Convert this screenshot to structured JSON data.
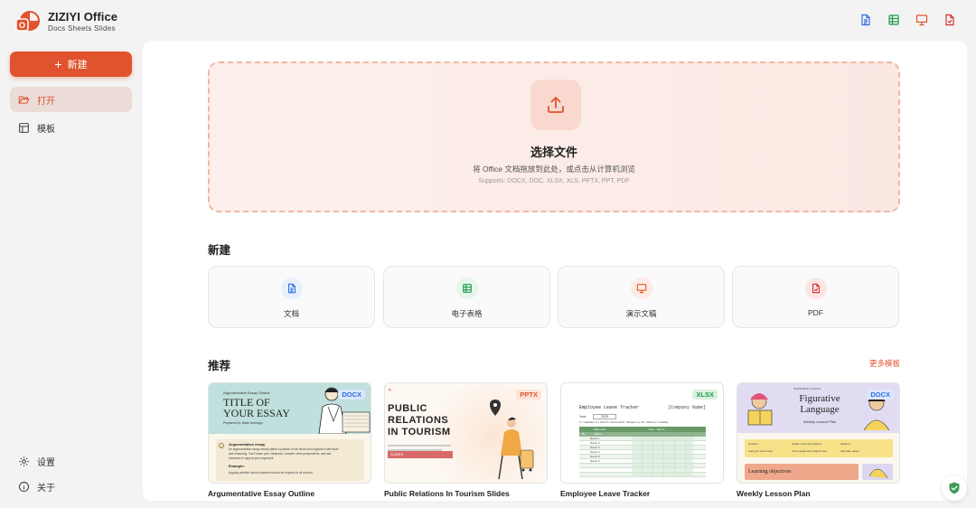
{
  "app": {
    "title": "ZIZIYI Office",
    "subtitle": "Docs  Sheets  Slides"
  },
  "sidebar": {
    "new_button": "新建",
    "items": [
      {
        "label": "打开",
        "icon": "folder-open-icon",
        "active": true
      },
      {
        "label": "模板",
        "icon": "template-icon",
        "active": false
      }
    ],
    "bottom": [
      {
        "label": "设置",
        "icon": "gear-icon"
      },
      {
        "label": "关于",
        "icon": "info-icon"
      }
    ]
  },
  "header_icons": [
    "doc-icon",
    "sheet-icon",
    "slides-icon",
    "pdf-icon"
  ],
  "upload": {
    "title": "选择文件",
    "description": "将 Office 文档拖放到此处，或点击从计算机浏览",
    "supports": "Supports: DOCX, DOC, XLSX, XLS, PPTX, PPT, PDF"
  },
  "new_section": {
    "title": "新建",
    "cards": [
      {
        "label": "文档",
        "icon": "document-icon",
        "color": "#2f6fe0",
        "bg": "#e8f0fd"
      },
      {
        "label": "电子表格",
        "icon": "spreadsheet-icon",
        "color": "#1e9a4b",
        "bg": "#e6f5ec"
      },
      {
        "label": "演示文稿",
        "icon": "presentation-icon",
        "color": "#e0532e",
        "bg": "#fdebe5"
      },
      {
        "label": "PDF",
        "icon": "pdf-file-icon",
        "color": "#d93030",
        "bg": "#fbe6e6"
      }
    ]
  },
  "recommend_section": {
    "title": "推荐",
    "more_link": "更多模板",
    "templates": [
      {
        "name": "Argumentative Essay Outline",
        "badge": "DOCX",
        "thumb": {
          "kicker": "Argumentative Essay Outline",
          "heading_line1": "TITLE OF",
          "heading_line2": "YOUR ESSAY",
          "byline": "Prepared by: Aiste Domingo",
          "box_title": "Argumentative essay",
          "box_line1": "An argumentative essay clearly states a position on an issue and supports it with facts",
          "box_line2": "and reasoning. You'll share your viewpoint, consider other perspectives, and use",
          "box_line3": "evidence to support your argument.",
          "example_label": "Example:",
          "example_text": "Arguing whether school uniforms should be required in all schools."
        }
      },
      {
        "name": "Public Relations In Tourism Slides",
        "badge": "PPTX",
        "thumb": {
          "line1": "PUBLIC",
          "line2": "RELATIONS",
          "line3": "IN TOURISM",
          "tag": "SLIDES"
        }
      },
      {
        "name": "Employee Leave Tracker",
        "badge": "XLSX",
        "thumb": {
          "title": "Employee Leave Tracker",
          "company": "[Company Name]",
          "year_label": "Year:",
          "year_value": "2025",
          "legend": "V = Vacation   S = Sick   P = Personal   B = Bereav. Lv.   W = Work   H = Holiday",
          "header_main": "Main view",
          "header_month": "Year – July %",
          "col_id": "ID",
          "col_name": "Name",
          "rows": [
            "Name 1",
            "Name 2",
            "Name 3",
            "Name 4",
            "Name 5",
            "Name 6"
          ]
        }
      },
      {
        "name": "Weekly Lesson Plan",
        "badge": "DOCX",
        "thumb": {
          "school": "NORTHERN SCHOOL",
          "heading_line1": "Figurative",
          "heading_line2": "Language",
          "subheading": "Weekly Lesson Plan",
          "cell1": "Teacher:",
          "cell2": "Grade Level and Subject:",
          "cell3": "Week of:",
          "cell4": "Add your name here",
          "cell5": "Insert grade and subject here",
          "cell6": "Add date range",
          "objectives": "Learning objectives"
        }
      }
    ]
  },
  "colors": {
    "accent": "#e0532e",
    "doc": "#2f6fe0",
    "sheet": "#1e9a4b",
    "slides": "#e0532e",
    "pdf": "#d93030"
  }
}
